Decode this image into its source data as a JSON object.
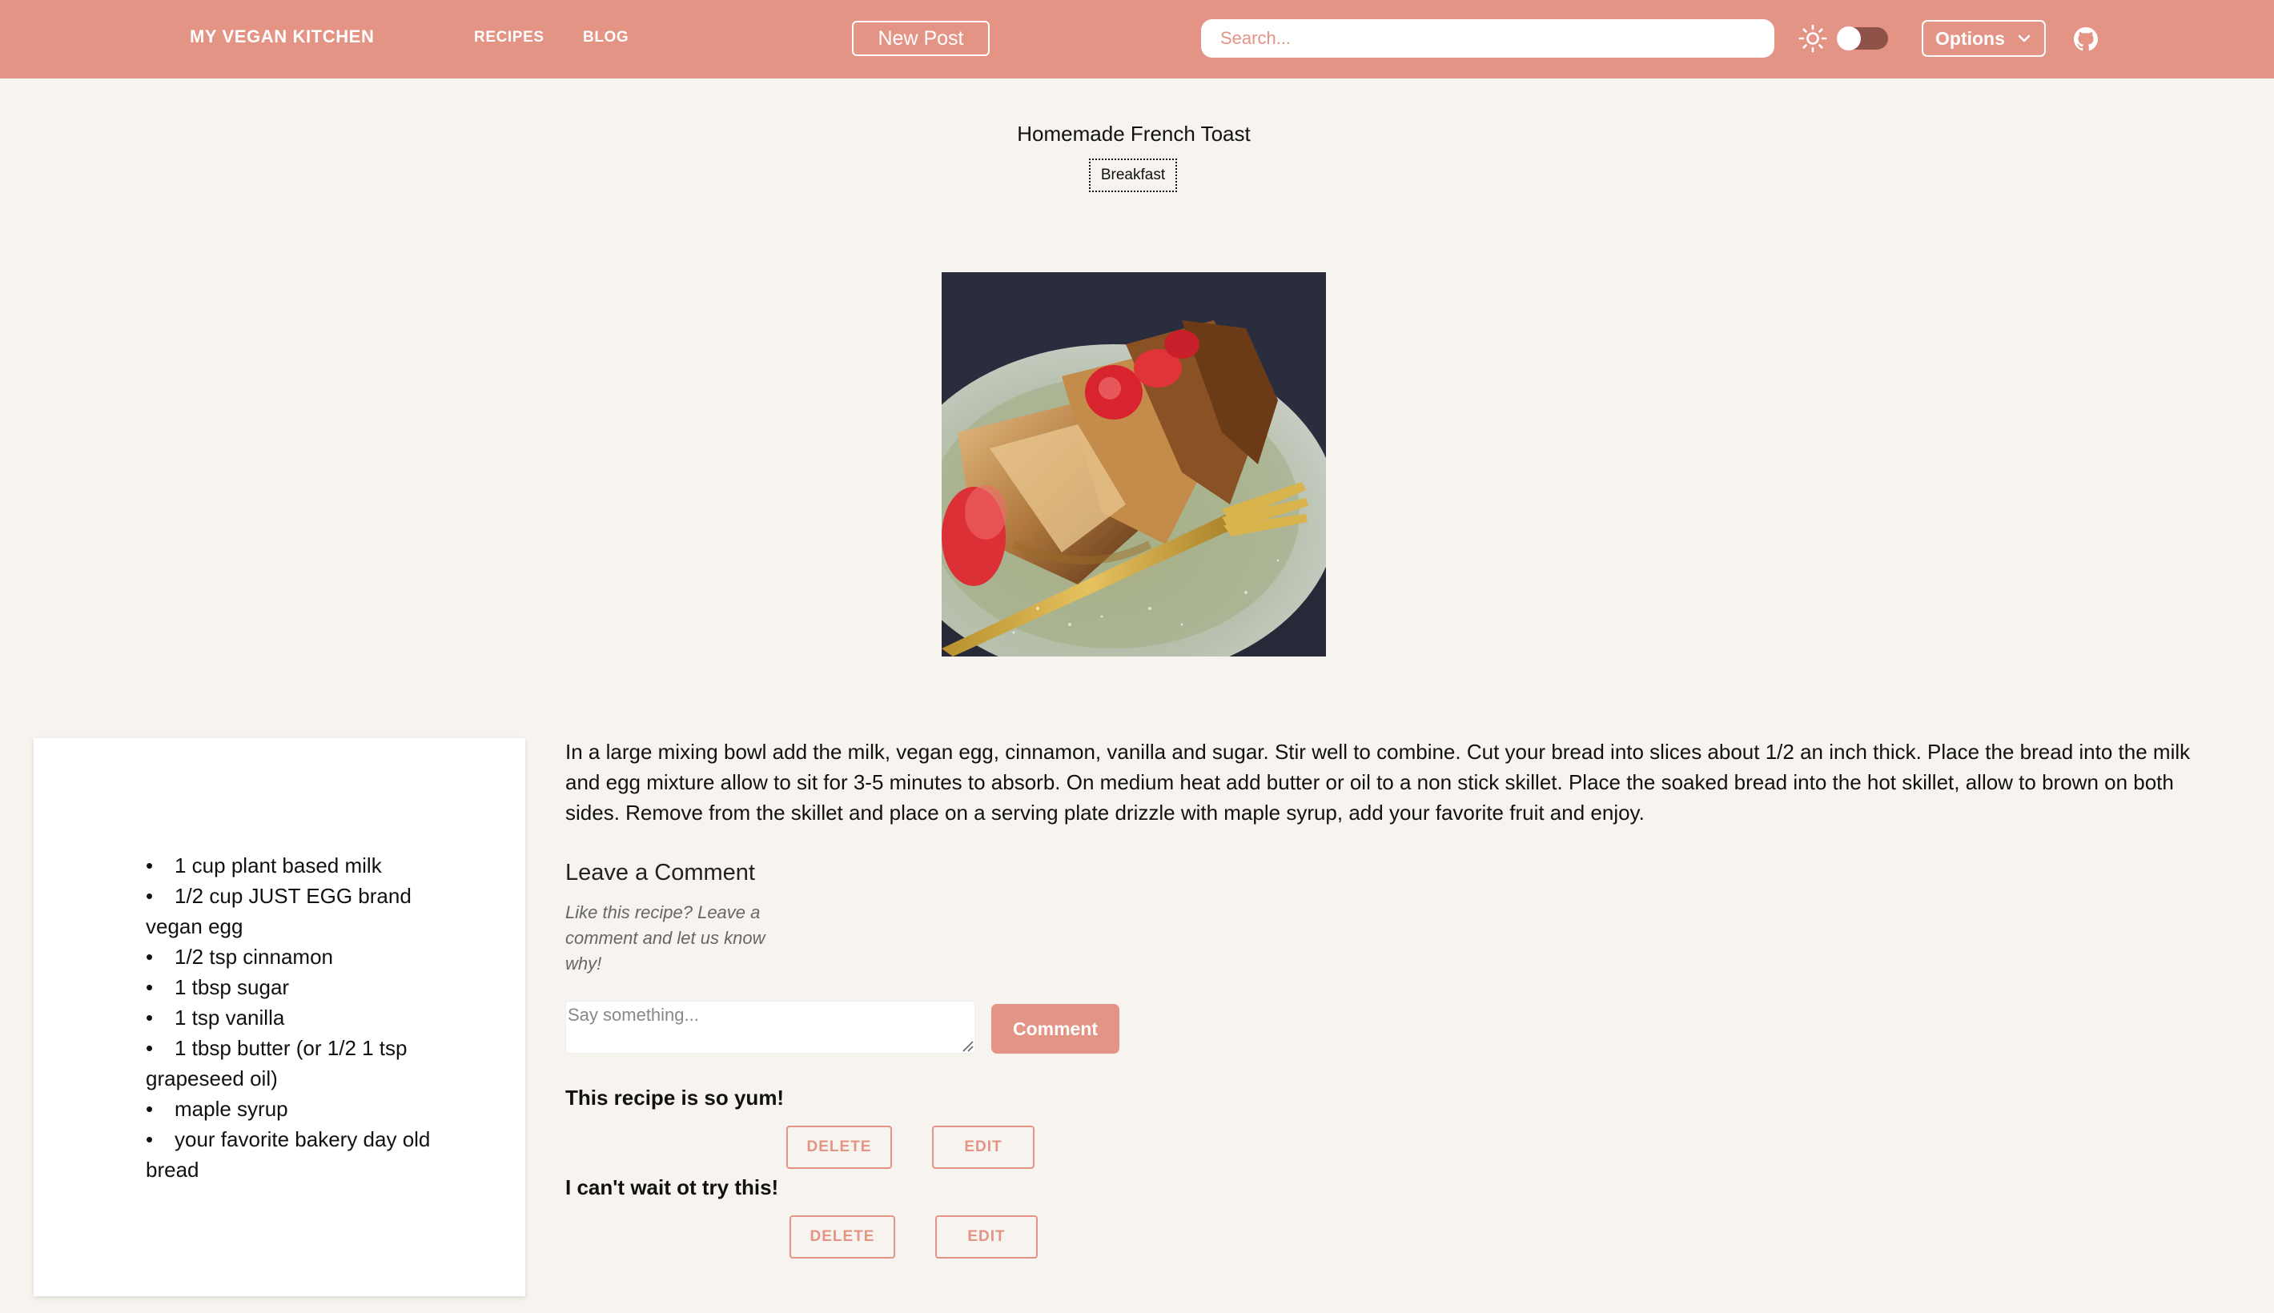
{
  "colors": {
    "accent": "#e49484",
    "background": "#f7f4ef",
    "toggle_track": "#8e5248"
  },
  "navbar": {
    "brand": "MY VEGAN KITCHEN",
    "links": [
      {
        "label": "RECIPES"
      },
      {
        "label": "BLOG"
      }
    ],
    "new_post_label": "New Post",
    "search_placeholder": "Search...",
    "theme_icon": "sun-icon",
    "options_label": "Options",
    "options_icon": "chevron-down-icon",
    "github_icon": "github-icon"
  },
  "recipe": {
    "title": "Homemade French Toast",
    "tag": "Breakfast",
    "image_icon": "french-toast-photo",
    "ingredients": [
      "1 cup plant based milk",
      "1/2 cup JUST EGG brand vegan egg",
      "1/2 tsp cinnamon",
      "1 tbsp sugar",
      "1 tsp vanilla",
      "1 tbsp butter (or 1/2 1 tsp grapeseed oil)",
      "maple syrup",
      "your favorite bakery day old bread"
    ],
    "instructions": "In a large mixing bowl add the milk, vegan egg, cinnamon, vanilla and sugar. Stir well to combine. Cut your bread into slices about 1/2 an inch thick. Place the bread into the milk and egg mixture allow to sit for 3-5 minutes to absorb. On medium heat add butter or oil to a non stick skillet. Place the soaked bread into the hot skillet, allow to brown on both sides. Remove from the skillet and place on a serving plate drizzle with maple syrup, add your favorite fruit and enjoy."
  },
  "comments_section": {
    "heading": "Leave a Comment",
    "subtext": "Like this recipe? Leave a comment and let us know why!",
    "input_placeholder": "Say something...",
    "submit_label": "Comment",
    "comments": [
      {
        "text": "This recipe is so yum!",
        "delete_label": "DELETE",
        "edit_label": "EDIT"
      },
      {
        "text": "I can't wait ot try this!",
        "delete_label": "DELETE",
        "edit_label": "EDIT"
      }
    ]
  }
}
